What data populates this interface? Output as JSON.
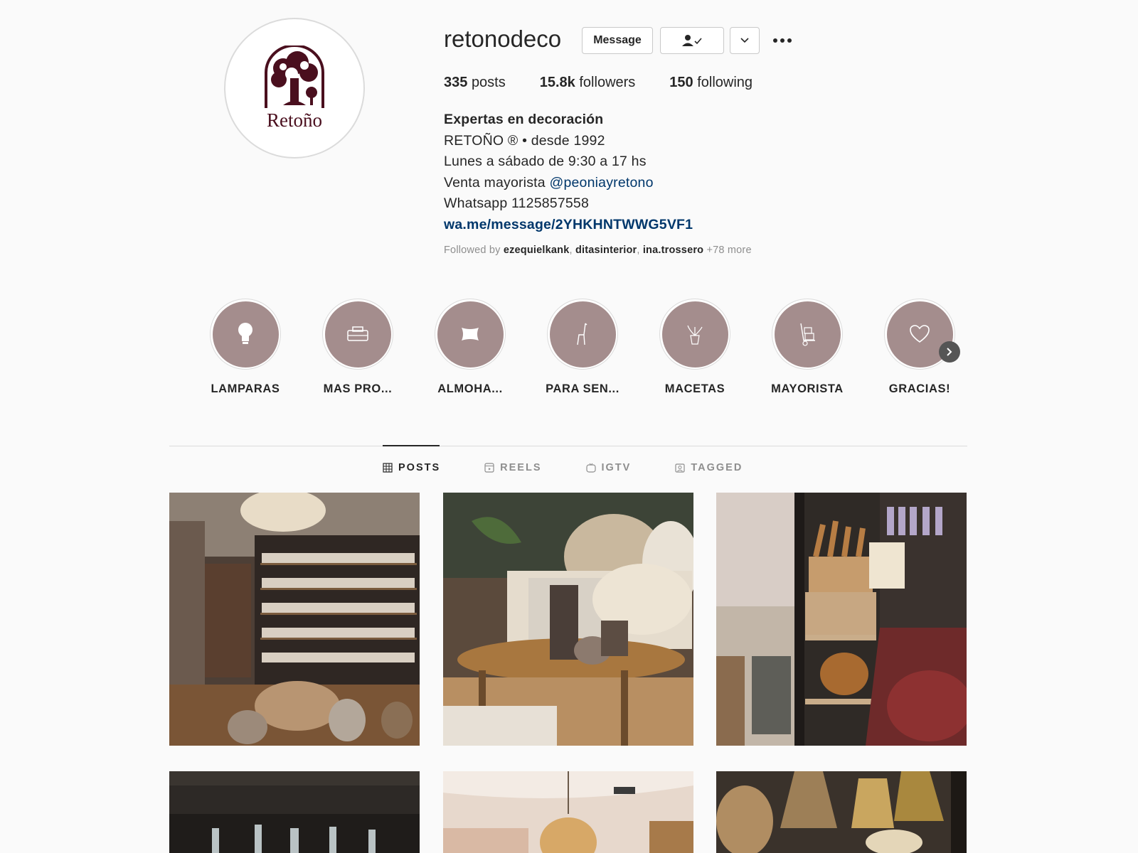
{
  "profile": {
    "username": "retonodeco",
    "avatar_logo_text": "Retoño",
    "message_button": "Message",
    "follow_icon": "person-check-icon",
    "chevron_icon": "chevron-down-icon",
    "more_icon": "more-horizontal-icon"
  },
  "stats": {
    "posts_count": "335",
    "posts_label": "posts",
    "followers_count": "15.8k",
    "followers_label": "followers",
    "following_count": "150",
    "following_label": "following"
  },
  "bio": {
    "name": "Expertas en decoración",
    "line1": "RETOÑO ® • desde 1992",
    "line2": "Lunes a sábado de 9:30 a 17 hs",
    "line3_prefix": "Venta mayorista",
    "line3_mention": "@peoniayretono",
    "line4": "Whatsapp 1125857558",
    "link": "wa.me/message/2YHKHNTWWG5VF1"
  },
  "followed_by": {
    "prefix": "Followed by",
    "users": [
      "ezequielkank",
      "ditasinterior",
      "ina.trossero"
    ],
    "more": "+78 more"
  },
  "highlights": [
    {
      "label": "LAMPARAS",
      "icon": "lightbulb-icon"
    },
    {
      "label": "MAS PRO...",
      "icon": "sewing-machine-icon"
    },
    {
      "label": "ALMOHA...",
      "icon": "pillow-icon"
    },
    {
      "label": "PARA SEN...",
      "icon": "chair-icon"
    },
    {
      "label": "MACETAS",
      "icon": "plant-pot-icon"
    },
    {
      "label": "MAYORISTA",
      "icon": "hand-truck-icon"
    },
    {
      "label": "GRACIAS!",
      "icon": "heart-icon"
    }
  ],
  "highlights_next_icon": "chevron-right-icon",
  "tabs": [
    {
      "label": "POSTS",
      "icon": "grid-icon",
      "active": true
    },
    {
      "label": "REELS",
      "icon": "reels-icon",
      "active": false
    },
    {
      "label": "IGTV",
      "icon": "igtv-icon",
      "active": false
    },
    {
      "label": "TAGGED",
      "icon": "tagged-icon",
      "active": false
    }
  ],
  "posts": [
    {
      "subject": "shop-interior-shelves"
    },
    {
      "subject": "side-table-vases"
    },
    {
      "subject": "wooden-utensils-baskets"
    },
    {
      "subject": "glass-bottles"
    },
    {
      "subject": "pendant-lamp-shop"
    },
    {
      "subject": "wicker-hanging-lamps"
    }
  ],
  "colors": {
    "highlight_fill": "#a48d8d",
    "link": "#00376b",
    "logo": "#4a0f1e"
  }
}
